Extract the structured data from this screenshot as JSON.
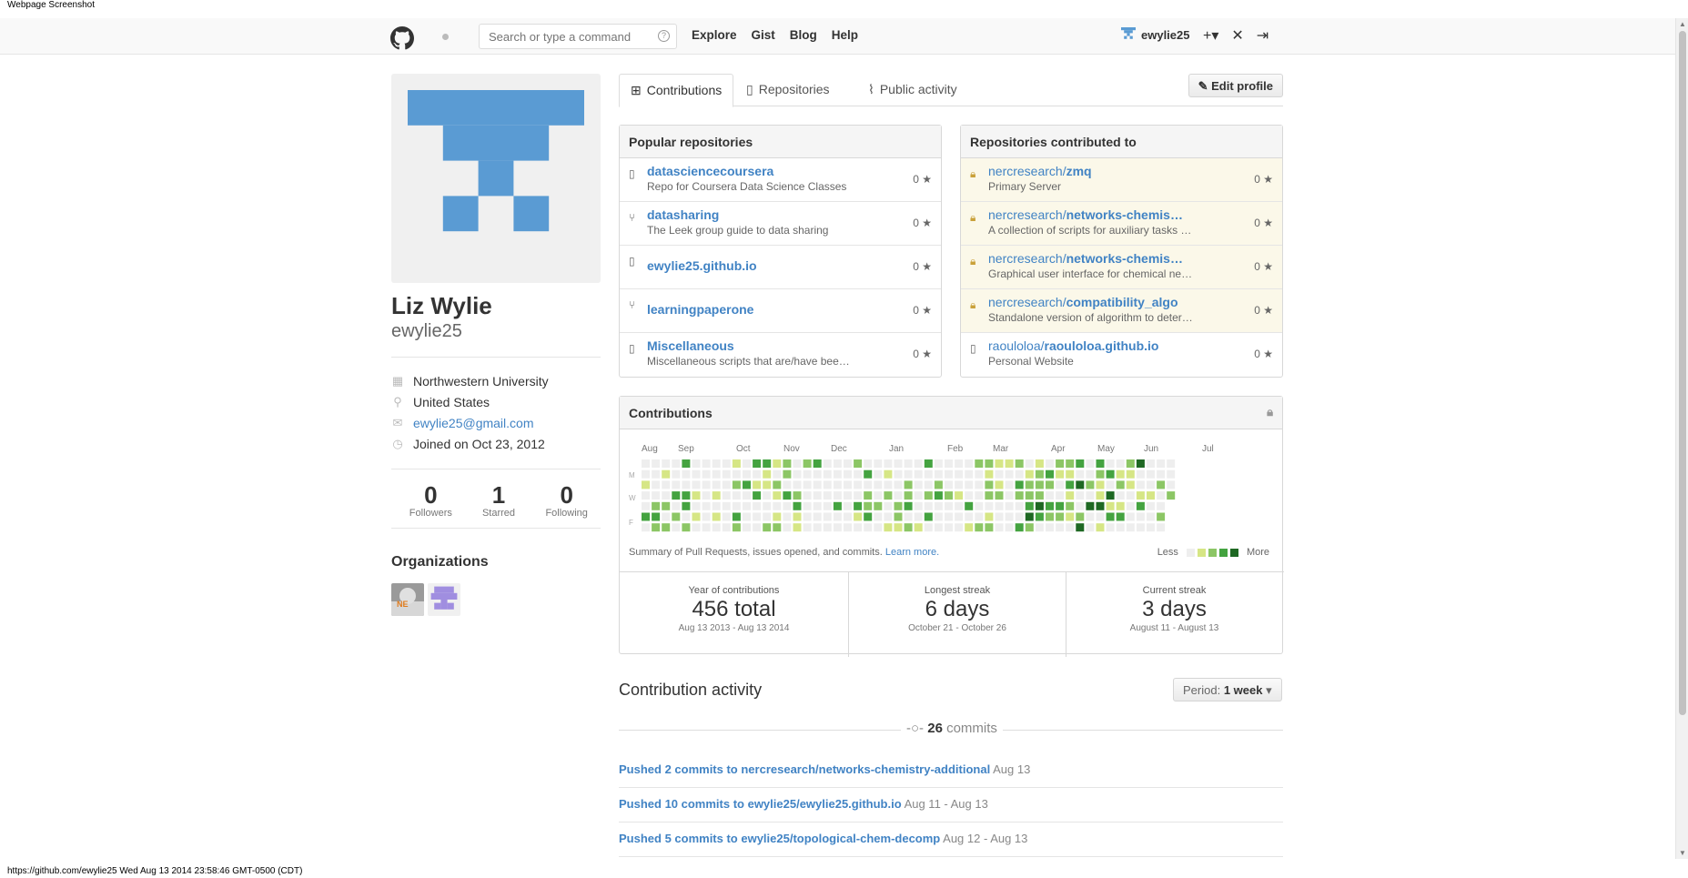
{
  "captions": {
    "top": "Webpage Screenshot",
    "bottom": "https://github.com/ewylie25 Wed Aug 13 2014 23:58:46 GMT-0500 (CDT)"
  },
  "header": {
    "search_placeholder": "Search or type a command",
    "search_help": "?",
    "nav": [
      "Explore",
      "Gist",
      "Blog",
      "Help"
    ],
    "username": "ewylie25",
    "plus": "+▾"
  },
  "profile": {
    "fullname": "Liz Wylie",
    "username": "ewylie25",
    "organization": "Northwestern University",
    "location": "United States",
    "email": "ewylie25@gmail.com",
    "joined": "Joined on Oct 23, 2012",
    "stats": [
      {
        "value": "0",
        "label": "Followers"
      },
      {
        "value": "1",
        "label": "Starred"
      },
      {
        "value": "0",
        "label": "Following"
      }
    ],
    "organizations_heading": "Organizations"
  },
  "tabs": {
    "contributions": "Contributions",
    "repositories": "Repositories",
    "public_activity": "Public activity",
    "edit_profile": "Edit profile"
  },
  "popular": {
    "heading": "Popular repositories",
    "repos": [
      {
        "name": "datasciencecoursera",
        "desc": "Repo for Coursera Data Science Classes",
        "stars": "0",
        "icon": "repo-icon"
      },
      {
        "name": "datasharing",
        "desc": "The Leek group guide to data sharing",
        "stars": "0",
        "icon": "fork-icon"
      },
      {
        "name": "ewylie25.github.io",
        "desc": "",
        "stars": "0",
        "icon": "repo-icon"
      },
      {
        "name": "learningpaperone",
        "desc": "",
        "stars": "0",
        "icon": "fork-icon"
      },
      {
        "name": "Miscellaneous",
        "desc": "Miscellaneous scripts that are/have bee…",
        "stars": "0",
        "icon": "repo-icon"
      }
    ]
  },
  "contributed": {
    "heading": "Repositories contributed to",
    "repos": [
      {
        "owner": "nercresearch/",
        "name": "zmq",
        "desc": "Primary Server",
        "stars": "0",
        "private": true
      },
      {
        "owner": "nercresearch/",
        "name": "networks-chemis…",
        "desc": "A collection of scripts for auxiliary tasks …",
        "stars": "0",
        "private": true
      },
      {
        "owner": "nercresearch/",
        "name": "networks-chemis…",
        "desc": "Graphical user interface for chemical ne…",
        "stars": "0",
        "private": true
      },
      {
        "owner": "nercresearch/",
        "name": "compatibility_algo",
        "desc": "Standalone version of algorithm to deter…",
        "stars": "0",
        "private": true
      },
      {
        "owner": "raouloloa/",
        "name": "raouloloa.github.io",
        "desc": "Personal Website",
        "stars": "0",
        "private": false
      }
    ]
  },
  "contrib_graph": {
    "heading": "Contributions",
    "months": [
      "Aug",
      "Sep",
      "Oct",
      "Nov",
      "Dec",
      "Jan",
      "Feb",
      "Mar",
      "Apr",
      "May",
      "Jun",
      "Jul"
    ],
    "day_labels": [
      "M",
      "W",
      "F"
    ],
    "summary": "Summary of Pull Requests, issues opened, and commits.",
    "learn_more": "Learn more.",
    "less": "Less",
    "more": "More",
    "colors": [
      "#eeeeee",
      "#d6e685",
      "#8cc665",
      "#44a340",
      "#1e6823"
    ]
  },
  "streaks": [
    {
      "title": "Year of contributions",
      "value": "456 total",
      "range": "Aug 13 2013 - Aug 13 2014"
    },
    {
      "title": "Longest streak",
      "value": "6 days",
      "range": "October 21 - October 26"
    },
    {
      "title": "Current streak",
      "value": "3 days",
      "range": "August 11 - August 13"
    }
  ],
  "activity": {
    "heading": "Contribution activity",
    "period_label": "Period:",
    "period_value": "1 week",
    "commit_count": "26",
    "commit_word": "commits",
    "items": [
      {
        "text": "Pushed 2 commits to nercresearch/networks-chemistry-additional",
        "date": "Aug 13"
      },
      {
        "text": "Pushed 10 commits to ewylie25/ewylie25.github.io",
        "date": "Aug 11 - Aug 13"
      },
      {
        "text": "Pushed 5 commits to ewylie25/topological-chem-decomp",
        "date": "Aug 12 - Aug 13"
      }
    ]
  }
}
